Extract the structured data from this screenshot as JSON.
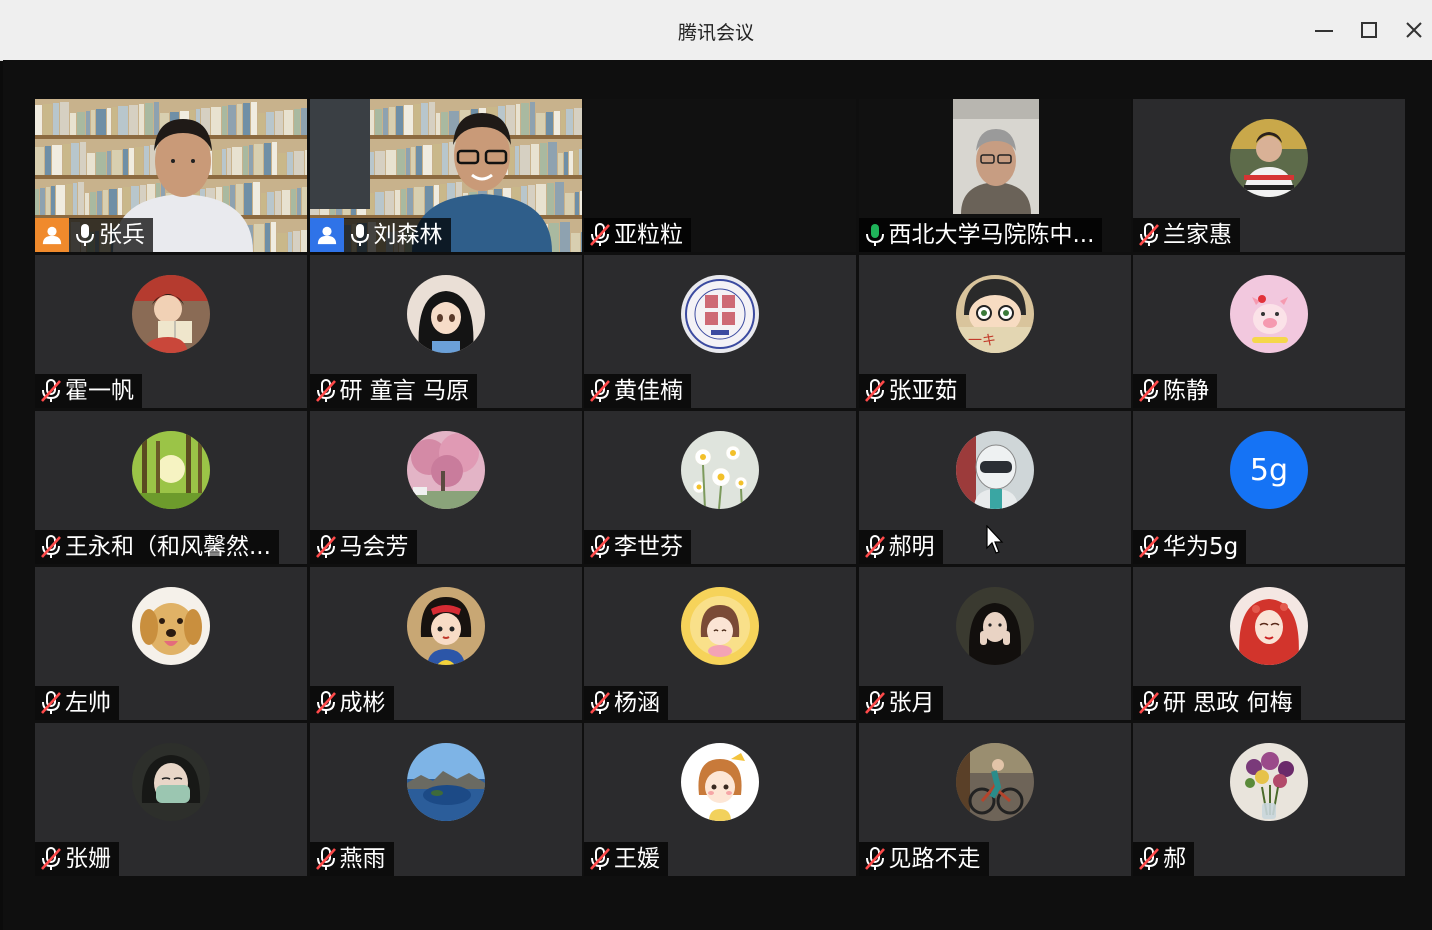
{
  "window": {
    "title": "腾讯会议",
    "controls": [
      "minimize-icon",
      "maximize-icon",
      "close-icon"
    ]
  },
  "colors": {
    "host_badge": "#f08a2c",
    "cohost_badge": "#2f73e8",
    "speaking_border": "#1fb35a",
    "mic_on": "#ffffff",
    "mic_speaking": "#1fb35a",
    "mic_muted": "#ff4a4a",
    "tile_bg": "#2b2b2d",
    "avatar_5g": "#1573f5"
  },
  "participants": [
    {
      "name": "张兵",
      "role": "host",
      "mic": "on",
      "view": "video"
    },
    {
      "name": "刘森林",
      "role": "cohost",
      "mic": "on",
      "view": "video",
      "active": true
    },
    {
      "name": "亚粒粒",
      "mic": "muted",
      "view": "none"
    },
    {
      "name": "西北大学马院陈中...",
      "mic": "speaking",
      "view": "video-portrait"
    },
    {
      "name": "兰家惠",
      "mic": "muted",
      "view": "avatar",
      "avatar_icon": "man-photo-icon"
    },
    {
      "name": "霍一帆",
      "mic": "muted",
      "view": "avatar",
      "avatar_icon": "anime-boy-reading-icon"
    },
    {
      "name": "研 童言 马原",
      "mic": "muted",
      "view": "avatar",
      "avatar_icon": "anime-girl-icon"
    },
    {
      "name": "黄佳楠",
      "mic": "muted",
      "view": "avatar",
      "avatar_icon": "university-seal-icon"
    },
    {
      "name": "张亚茹",
      "mic": "muted",
      "view": "avatar",
      "avatar_icon": "anime-face-icon"
    },
    {
      "name": "陈静",
      "mic": "muted",
      "view": "avatar",
      "avatar_icon": "cartoon-pig-icon"
    },
    {
      "name": "王永和（和风馨然...",
      "mic": "muted",
      "view": "avatar",
      "avatar_icon": "forest-icon"
    },
    {
      "name": "马会芳",
      "mic": "muted",
      "view": "avatar",
      "avatar_icon": "cherry-blossom-icon"
    },
    {
      "name": "李世芬",
      "mic": "muted",
      "view": "avatar",
      "avatar_icon": "daisy-flowers-icon"
    },
    {
      "name": "郝明",
      "mic": "muted",
      "view": "avatar",
      "avatar_icon": "helmet-rider-icon"
    },
    {
      "name": "华为5g",
      "mic": "muted",
      "view": "avatar",
      "avatar_icon": "text-avatar-icon",
      "avatar_text": "5g"
    },
    {
      "name": "左帅",
      "mic": "muted",
      "view": "avatar",
      "avatar_icon": "golden-retriever-icon"
    },
    {
      "name": "成彬",
      "mic": "muted",
      "view": "avatar",
      "avatar_icon": "cartoon-princess-icon"
    },
    {
      "name": "杨涵",
      "mic": "muted",
      "view": "avatar",
      "avatar_icon": "cartoon-girl-sun-icon"
    },
    {
      "name": "张月",
      "mic": "muted",
      "view": "avatar",
      "avatar_icon": "woman-photo-icon"
    },
    {
      "name": "研 思政 何梅",
      "mic": "muted",
      "view": "avatar",
      "avatar_icon": "red-hair-woman-icon"
    },
    {
      "name": "张姗",
      "mic": "muted",
      "view": "avatar",
      "avatar_icon": "masked-face-icon"
    },
    {
      "name": "燕雨",
      "mic": "muted",
      "view": "avatar",
      "avatar_icon": "crater-lake-icon"
    },
    {
      "name": "王媛",
      "mic": "muted",
      "view": "avatar",
      "avatar_icon": "cartoon-girl-icon"
    },
    {
      "name": "见路不走",
      "mic": "muted",
      "view": "avatar",
      "avatar_icon": "cyclist-icon"
    },
    {
      "name": "郝",
      "mic": "muted",
      "view": "avatar",
      "avatar_icon": "flower-bouquet-icon"
    }
  ]
}
